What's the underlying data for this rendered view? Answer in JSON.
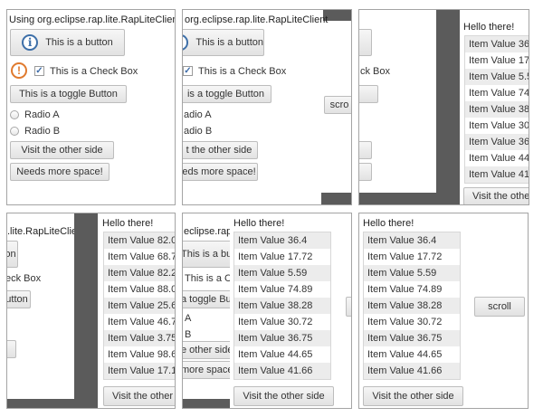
{
  "shell": {
    "title": "Using org.eclipse.rap.lite.RapLiteClient",
    "title_p2": "org.eclipse.rap.lite.RapLiteClient",
    "title_p4": ".lite.RapLiteClient",
    "title_p5": ".eclipse.rap.",
    "button_label": "This is a button",
    "button_p5": "This is a butt",
    "checkbox_label": "This is a Check Box",
    "checkbox_p3": "ck Box",
    "checkbox_p4": "eck Box",
    "checkbox_p5": "This is a Ch",
    "toggle_label": "This is a toggle Button",
    "toggle_p2": "is a toggle Button",
    "toggle_p3": "tton",
    "toggle_p4": "utton",
    "toggle_p5": "a toggle Butt",
    "radio_a": "Radio A",
    "radio_b": "Radio B",
    "radio_a_p2": "adio A",
    "radio_b_p2": "adio B",
    "radio_a_p5": "A",
    "radio_b_p5": "B",
    "visit_label": "Visit the other side",
    "visit_p2": "t the other side",
    "visit_p5": "e other side",
    "visit_p6": "Visit the other",
    "needs_label": "Needs more space!",
    "needs_p2": "eds more space!",
    "needs_p5": "more space!",
    "btn_frag_on": "on",
    "btn_frag_ton": "ton",
    "scroll_label": "scroll",
    "scroll_p2": "scro",
    "hello_label": "Hello there!"
  },
  "list_a": [
    "Item Value 36.4",
    "Item Value 17.72",
    "Item Value 5.59",
    "Item Value 74.89",
    "Item Value 38.28",
    "Item Value 30.72",
    "Item Value 36.75",
    "Item Value 44.65",
    "Item Value 41.66"
  ],
  "list_b": [
    "Item Value 82.0",
    "Item Value 68.7",
    "Item Value 82.2",
    "Item Value 88.0",
    "Item Value 25.6",
    "Item Value 46.7",
    "Item Value 3.75",
    "Item Value 98.6",
    "Item Value 17.1"
  ],
  "colors": {
    "border": "#a4a4a4",
    "dark": "#5b5b5b",
    "info": "#3d6fa8",
    "warn": "#e07a2e",
    "row_alt": "#ececec"
  }
}
